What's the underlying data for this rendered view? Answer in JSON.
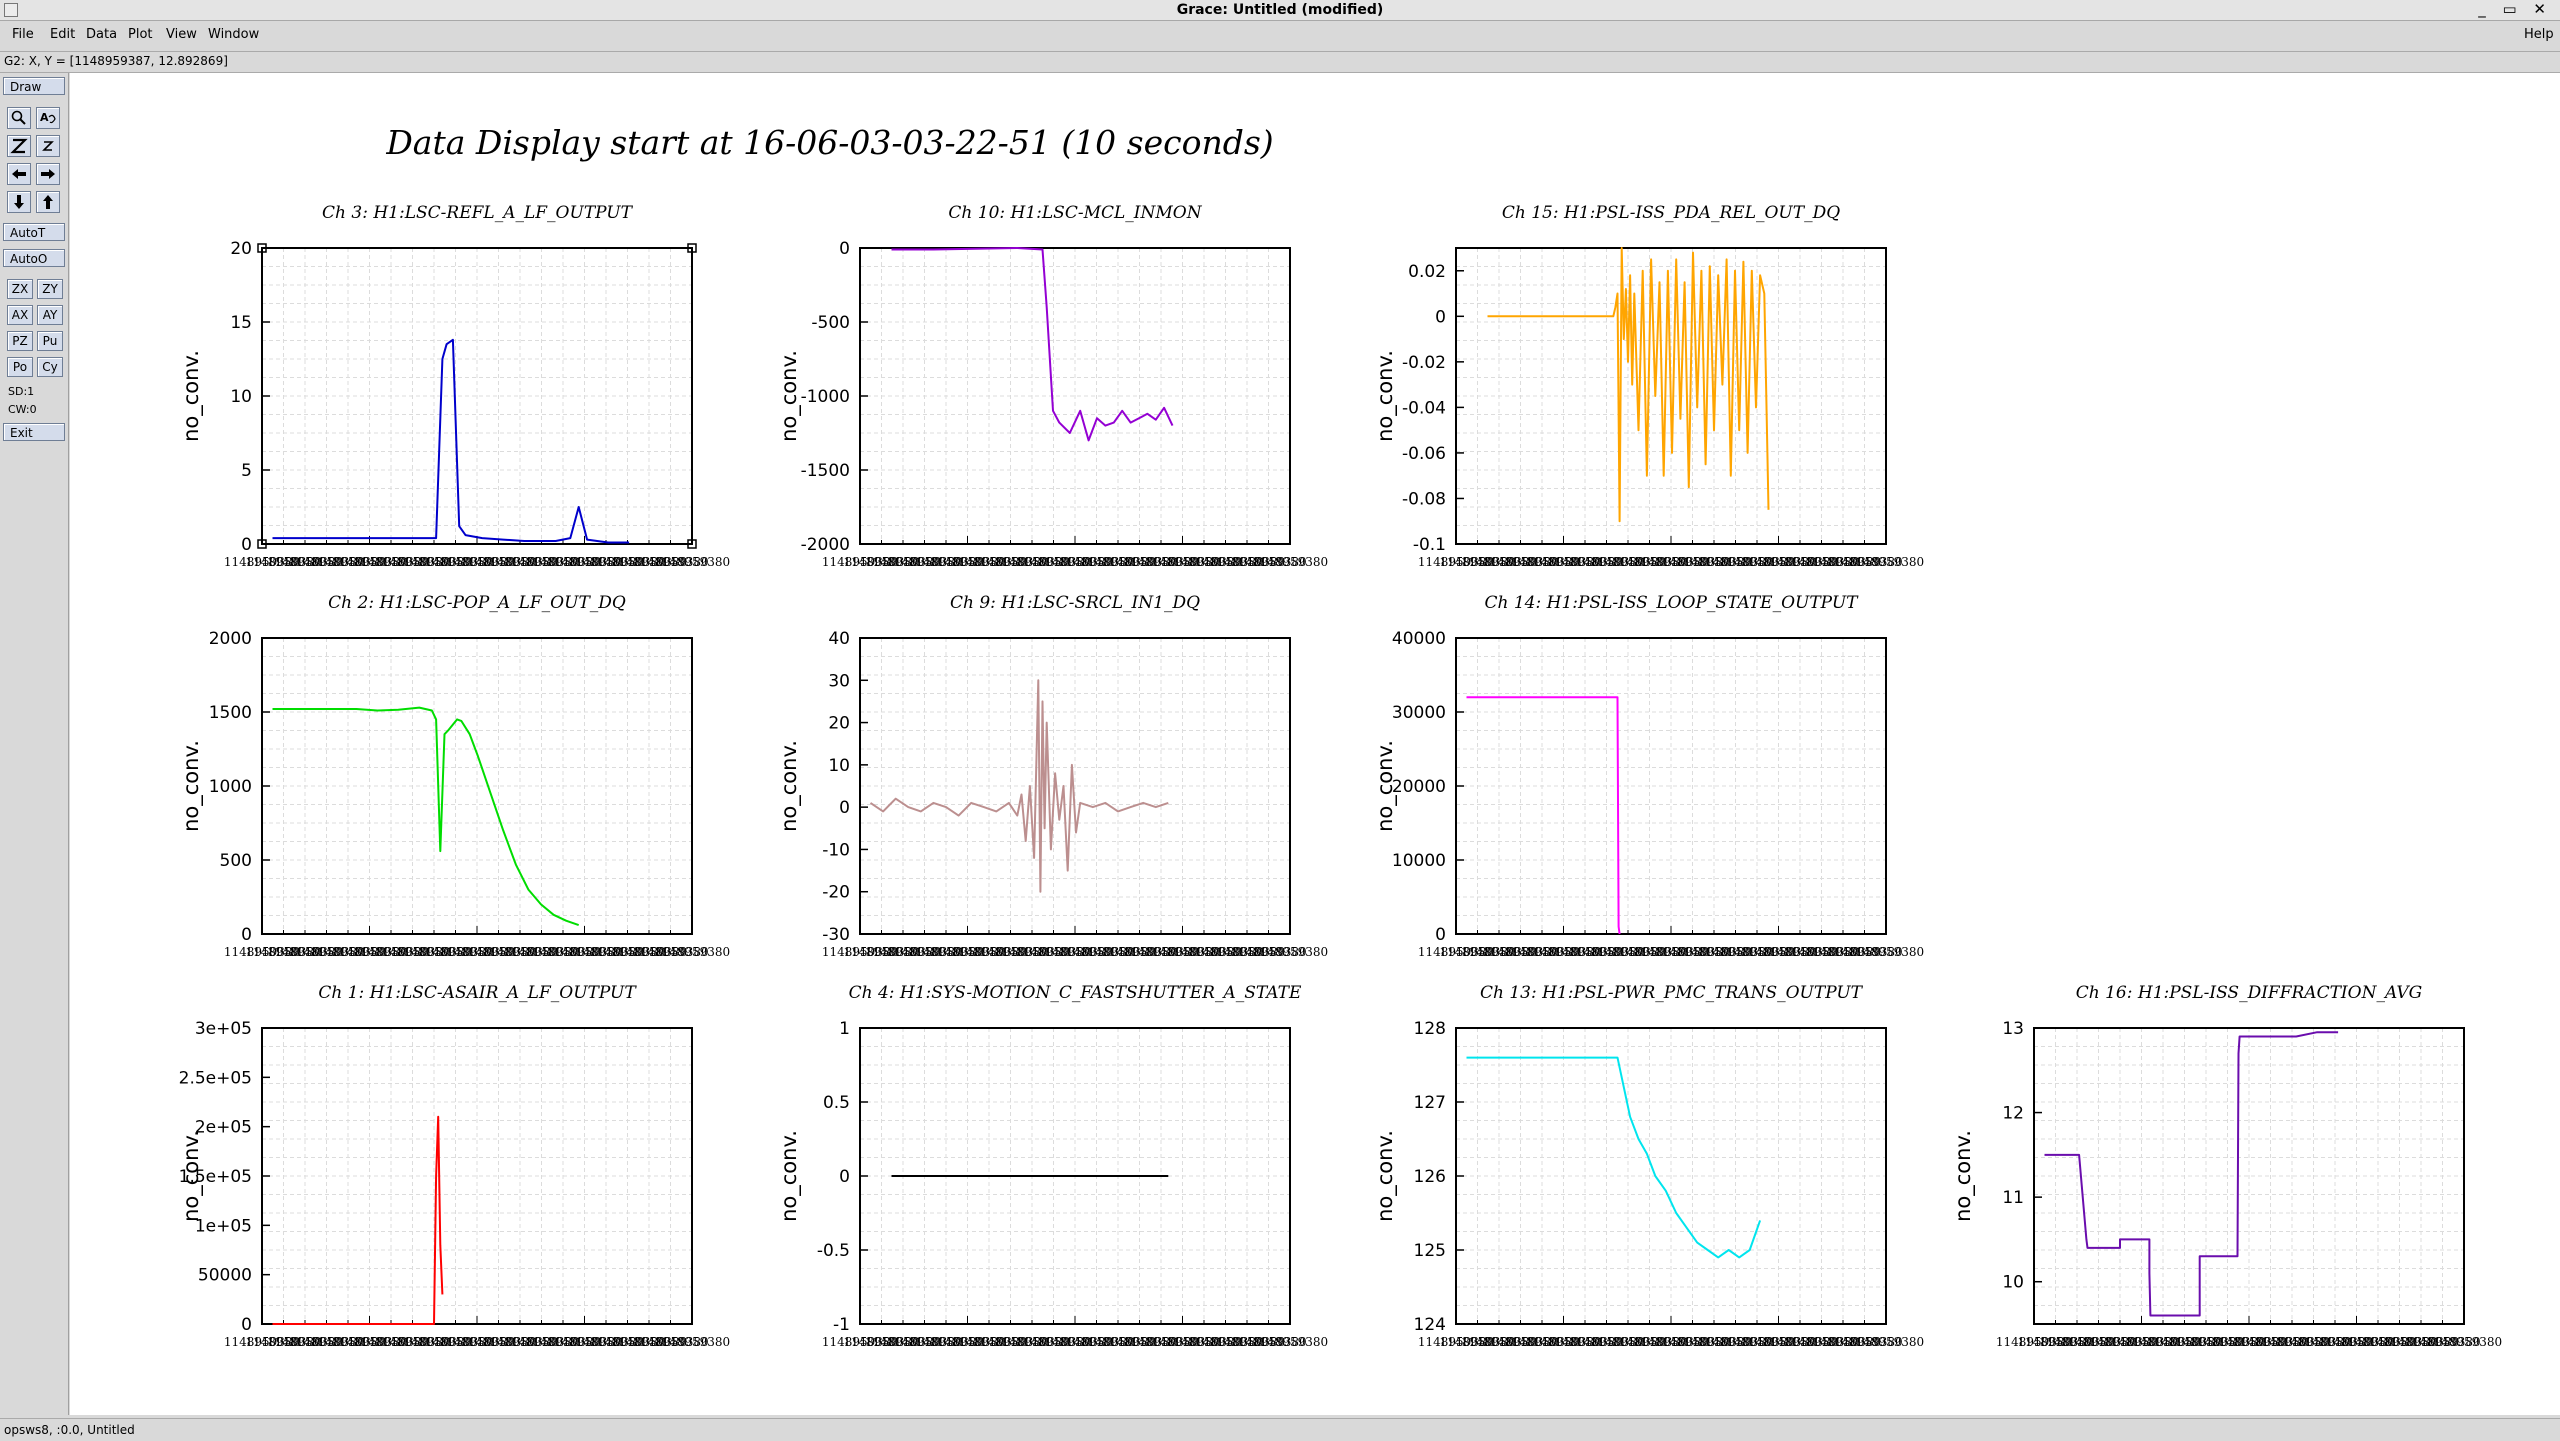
{
  "window": {
    "title": "Grace: Untitled (modified)",
    "controls": "_ ▭ ✕"
  },
  "menu": {
    "items": [
      "File",
      "Edit",
      "Data",
      "Plot",
      "View",
      "Window"
    ],
    "help": "Help"
  },
  "coord_readout": "G2: X, Y = [1148959387, 12.892869]",
  "toolbar": {
    "draw": "Draw",
    "autot": "AutoT",
    "autoo": "AutoO",
    "pairs": [
      [
        "ZX",
        "ZY"
      ],
      [
        "AX",
        "AY"
      ],
      [
        "PZ",
        "Pu"
      ],
      [
        "Po",
        "Cy"
      ]
    ],
    "sd": "SD:1",
    "cw": "CW:0",
    "exit": "Exit"
  },
  "status": "opsws8, :0.0, Untitled",
  "page_title": "Data Display start at 16-06-03-03-22-51 (10 seconds)",
  "ylabel": "no_conv.",
  "xtick_text": "1148959380",
  "chart_data": [
    {
      "type": "line",
      "title": "Ch 3: H1:LSC-REFL_A_LF_OUTPUT",
      "color": "#0000cc",
      "ylim": [
        0,
        20
      ],
      "yticks": [
        "0",
        "5",
        "10",
        "15",
        "20"
      ],
      "x": [
        0,
        4,
        7.8,
        8.1,
        8.3,
        8.6,
        8.9,
        9.2,
        10,
        11,
        12,
        13.5,
        14.2,
        14.6,
        15,
        16,
        17
      ],
      "y": [
        0.4,
        0.4,
        0.4,
        12.5,
        13.5,
        13.8,
        1.2,
        0.6,
        0.4,
        0.3,
        0.2,
        0.2,
        0.4,
        2.5,
        0.3,
        0.1,
        0.1
      ],
      "xlim": [
        -0.5,
        20
      ]
    },
    {
      "type": "line",
      "title": "Ch 10: H1:LSC-MCL_INMON",
      "color": "#9400d3",
      "ylim": [
        -2000,
        0
      ],
      "yticks": [
        "-2000",
        "-1500",
        "-1000",
        "-500",
        "0"
      ],
      "x": [
        1,
        3,
        5,
        7,
        8.2,
        8.4,
        8.7,
        9,
        9.5,
        10,
        10.4,
        10.8,
        11.2,
        11.6,
        12,
        12.4,
        12.8,
        13.2,
        13.6,
        14,
        14.4
      ],
      "y": [
        -10,
        -10,
        -5,
        0,
        -10,
        -400,
        -1100,
        -1180,
        -1250,
        -1100,
        -1300,
        -1150,
        -1200,
        -1180,
        -1100,
        -1180,
        -1150,
        -1120,
        -1160,
        -1080,
        -1200
      ],
      "xlim": [
        -0.5,
        20
      ]
    },
    {
      "type": "line",
      "title": "Ch 15: H1:PSL-ISS_PDA_REL_OUT_DQ",
      "color": "#ffa500",
      "ylim": [
        -0.1,
        0.03
      ],
      "yticks": [
        "-0.1",
        "-0.08",
        "-0.06",
        "-0.04",
        "-0.02",
        "0",
        "0.02"
      ],
      "x": [
        1,
        3,
        5,
        7,
        7.1,
        7.2,
        7.3,
        7.4,
        7.5,
        7.6,
        7.7,
        7.8,
        7.9,
        8,
        8.2,
        8.4,
        8.6,
        8.8,
        9,
        9.2,
        9.4,
        9.6,
        9.8,
        10,
        10.2,
        10.4,
        10.6,
        10.8,
        11,
        11.2,
        11.4,
        11.6,
        11.8,
        12,
        12.2,
        12.4,
        12.6,
        12.8,
        13,
        13.2,
        13.4,
        13.6,
        13.8,
        14,
        14.2,
        14.4
      ],
      "y": [
        0,
        0,
        0,
        0,
        0.004,
        0.01,
        -0.09,
        0.03,
        -0.01,
        0.012,
        -0.02,
        0.018,
        -0.03,
        0.01,
        -0.05,
        0.02,
        -0.07,
        0.025,
        -0.035,
        0.015,
        -0.07,
        0.02,
        -0.06,
        0.025,
        -0.045,
        0.015,
        -0.075,
        0.028,
        -0.04,
        0.02,
        -0.065,
        0.022,
        -0.05,
        0.018,
        -0.03,
        0.025,
        -0.07,
        0.02,
        -0.05,
        0.024,
        -0.06,
        0.02,
        -0.04,
        0.018,
        0.01,
        -0.085
      ],
      "xlim": [
        -0.5,
        20
      ]
    },
    {
      "type": "line",
      "title": "Ch 2: H1:LSC-POP_A_LF_OUT_DQ",
      "color": "#00dd00",
      "ylim": [
        0,
        2000
      ],
      "yticks": [
        "0",
        "500",
        "1000",
        "1500",
        "2000"
      ],
      "x": [
        0,
        2,
        4,
        5,
        6,
        7,
        7.6,
        7.8,
        8,
        8.2,
        8.4,
        8.8,
        9,
        9.4,
        9.8,
        10.4,
        11,
        11.6,
        12.2,
        12.8,
        13.4,
        14,
        14.6
      ],
      "y": [
        1520,
        1520,
        1520,
        1510,
        1515,
        1530,
        1510,
        1450,
        560,
        1350,
        1380,
        1450,
        1440,
        1350,
        1200,
        950,
        700,
        470,
        300,
        200,
        130,
        90,
        60
      ],
      "xlim": [
        -0.5,
        20
      ]
    },
    {
      "type": "line",
      "title": "Ch 9: H1:LSC-SRCL_IN1_DQ",
      "color": "#bc8f8f",
      "ylim": [
        -30,
        40
      ],
      "yticks": [
        "-30",
        "-20",
        "-10",
        "0",
        "10",
        "20",
        "30",
        "40"
      ],
      "x": [
        0,
        0.6,
        1.2,
        1.8,
        2.4,
        3,
        3.6,
        4.2,
        4.8,
        5.4,
        6,
        6.6,
        7,
        7.2,
        7.4,
        7.6,
        7.8,
        8,
        8.1,
        8.2,
        8.3,
        8.4,
        8.6,
        8.8,
        9,
        9.2,
        9.4,
        9.6,
        9.8,
        10,
        10.6,
        11.2,
        11.8,
        12.4,
        13,
        13.6,
        14.2
      ],
      "y": [
        1,
        -1,
        2,
        0,
        -1,
        1,
        0,
        -2,
        1,
        0,
        -1,
        1,
        -2,
        3,
        -8,
        5,
        -12,
        30,
        -20,
        25,
        -5,
        20,
        -10,
        8,
        -3,
        5,
        -15,
        10,
        -6,
        1,
        0,
        1,
        -1,
        0,
        1,
        0,
        1
      ],
      "xlim": [
        -0.5,
        20
      ]
    },
    {
      "type": "line",
      "title": "Ch 14: H1:PSL-ISS_LOOP_STATE_OUTPUT",
      "color": "#ff00ff",
      "ylim": [
        0,
        40000
      ],
      "yticks": [
        "0",
        "10000",
        "20000",
        "30000",
        "40000"
      ],
      "x": [
        0,
        3,
        6,
        7.2,
        7.25,
        7.3
      ],
      "y": [
        32000,
        32000,
        32000,
        32000,
        1000,
        0
      ],
      "xlim": [
        -0.5,
        20
      ]
    },
    {
      "type": "line",
      "title": "Ch 1: H1:LSC-ASAIR_A_LF_OUTPUT",
      "color": "#ff0000",
      "ylim": [
        0,
        300000
      ],
      "yticks": [
        "0",
        "50000",
        "1e+05",
        "1.5e+05",
        "2e+05",
        "2.5e+05",
        "3e+05"
      ],
      "x": [
        0,
        3,
        6,
        7.7,
        7.8,
        7.9,
        8,
        8.1
      ],
      "y": [
        0,
        0,
        0,
        0,
        150000,
        210000,
        80000,
        30000
      ],
      "xlim": [
        -0.5,
        20
      ]
    },
    {
      "type": "line",
      "title": "Ch 4: H1:SYS-MOTION_C_FASTSHUTTER_A_STATE",
      "color": "#000000",
      "ylim": [
        -1,
        1
      ],
      "yticks": [
        "-1",
        "-0.5",
        "0",
        "0.5",
        "1"
      ],
      "x": [
        1,
        14.2
      ],
      "y": [
        0,
        0
      ],
      "xlim": [
        -0.5,
        20
      ]
    },
    {
      "type": "line",
      "title": "Ch 13: H1:PSL-PWR_PMC_TRANS_OUTPUT",
      "color": "#00e5ee",
      "ylim": [
        124,
        128
      ],
      "yticks": [
        "124",
        "125",
        "126",
        "127",
        "128"
      ],
      "x": [
        0,
        2,
        4,
        6,
        7.2,
        7.5,
        7.8,
        8.2,
        8.6,
        9,
        9.5,
        10,
        10.5,
        11,
        11.5,
        12,
        12.5,
        13,
        13.5,
        14
      ],
      "y": [
        127.6,
        127.6,
        127.6,
        127.6,
        127.6,
        127.2,
        126.8,
        126.5,
        126.3,
        126,
        125.8,
        125.5,
        125.3,
        125.1,
        125,
        124.9,
        125,
        124.9,
        125,
        125.4
      ],
      "xlim": [
        -0.5,
        20
      ]
    },
    {
      "type": "line",
      "title": "Ch 16: H1:PSL-ISS_DIFFRACTION_AVG",
      "color": "#6a0dad",
      "ylim": [
        9.5,
        13
      ],
      "yticks": [
        "10",
        "11",
        "12",
        "13"
      ],
      "x": [
        0,
        1.6,
        1.65,
        2,
        2.05,
        3.6,
        3.6,
        5,
        5,
        5.05,
        5.1,
        7.4,
        7.4,
        8,
        8,
        9.2,
        9.25,
        9.3,
        10,
        11,
        12,
        13,
        14
      ],
      "y": [
        11.5,
        11.5,
        11.5,
        10.5,
        10.4,
        10.4,
        10.5,
        10.5,
        10.1,
        9.6,
        9.6,
        9.6,
        10.3,
        10.3,
        10.3,
        10.3,
        12.7,
        12.9,
        12.9,
        12.9,
        12.9,
        12.95,
        12.95
      ],
      "xlim": [
        -0.5,
        20
      ]
    }
  ]
}
